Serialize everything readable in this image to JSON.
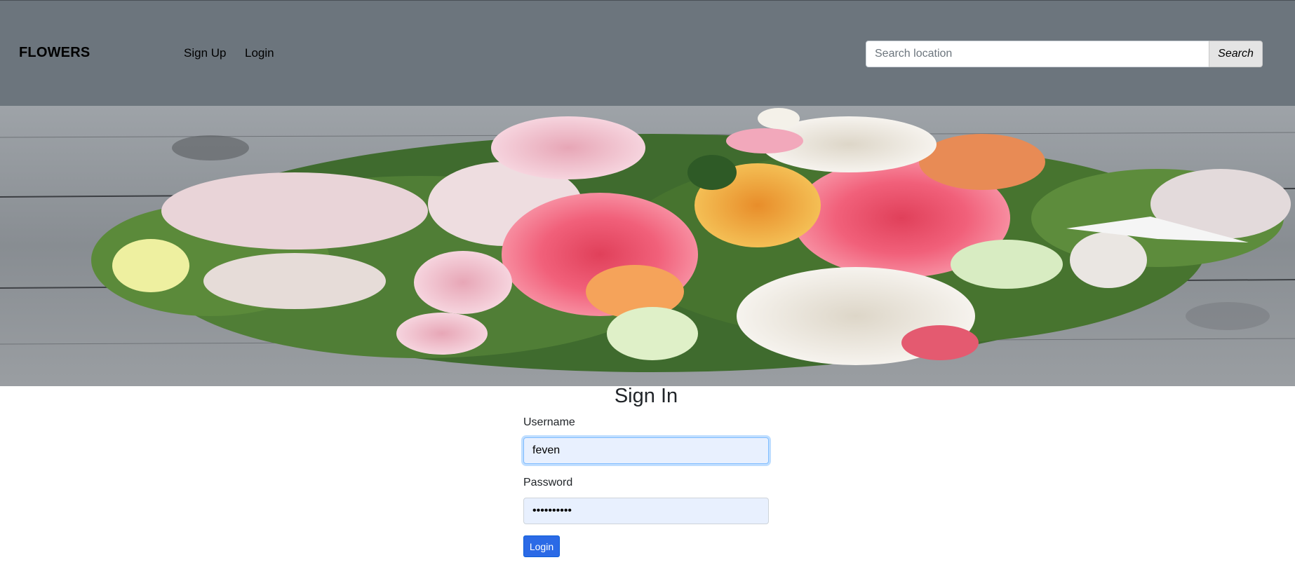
{
  "navbar": {
    "brand": "FLOWERS",
    "links": [
      {
        "label": "Sign Up"
      },
      {
        "label": "Login"
      }
    ],
    "search": {
      "placeholder": "Search location",
      "value": "",
      "button_label": "Search"
    },
    "background_color": "#6c757d"
  },
  "hero": {
    "image": "flower-bouquet-on-wooden-table"
  },
  "signin": {
    "title": "Sign In",
    "username_label": "Username",
    "username_value": "feven",
    "password_label": "Password",
    "password_value": "••••••••••",
    "login_button": "Login",
    "button_color": "#2b6ae6"
  }
}
